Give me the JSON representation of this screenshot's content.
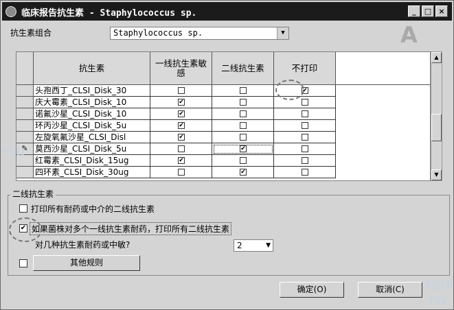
{
  "title": "临床报告抗生素 - Staphylococcus sp.",
  "titlebar_buttons": {
    "minimize": "_",
    "maximize": "□",
    "close": "×"
  },
  "combo": {
    "label": "抗生素组合",
    "value": "Staphylococcus sp."
  },
  "corner_letter": "A",
  "grid": {
    "headers": {
      "name": "抗生素",
      "first_line": "一线抗生素敏感",
      "second_line": "二线抗生素",
      "no_print": "不打印"
    },
    "rows": [
      {
        "name": "头孢西丁_CLSI_Disk_30",
        "first": false,
        "second": false,
        "noprint": true,
        "indicator": ""
      },
      {
        "name": "庆大霉素_CLSI_Disk_10",
        "first": true,
        "second": false,
        "noprint": false,
        "indicator": ""
      },
      {
        "name": "诺氟沙星_CLSI_Disk_10",
        "first": true,
        "second": false,
        "noprint": false,
        "indicator": ""
      },
      {
        "name": "环丙沙星_CLSI_Disk_5u",
        "first": true,
        "second": false,
        "noprint": false,
        "indicator": ""
      },
      {
        "name": "左旋氧氟沙星_CLSI_Disl",
        "first": true,
        "second": false,
        "noprint": false,
        "indicator": ""
      },
      {
        "name": "莫西沙星_CLSI_Disk_5u",
        "first": false,
        "second": true,
        "noprint": false,
        "indicator": "✎"
      },
      {
        "name": "红霉素_CLSI_Disk_15ug",
        "first": true,
        "second": false,
        "noprint": false,
        "indicator": ""
      },
      {
        "name": "四环素_CLSI_Disk_30ug",
        "first": false,
        "second": true,
        "noprint": false,
        "indicator": ""
      }
    ]
  },
  "second_line_group": {
    "title": "二线抗生素",
    "option1": {
      "label": "打印所有耐药或中介的二线抗生素",
      "checked": false
    },
    "option2": {
      "label": "如果菌株对多个一线抗生素耐药，打印所有二线抗生素",
      "checked": true
    },
    "count_label": "对几种抗生素耐药或中敏?",
    "count_value": "2",
    "other_rules_checked": false,
    "other_rules_button": "其他规则"
  },
  "buttons": {
    "ok": "确定(O)",
    "cancel": "取消(C)"
  },
  "watermark": {
    "line1": "TSU",
    "line2": ".TW"
  },
  "colors": {
    "titlebar": "#1b1b1b",
    "dialog": "#d4d4d4",
    "header": "#d9d9d9"
  }
}
